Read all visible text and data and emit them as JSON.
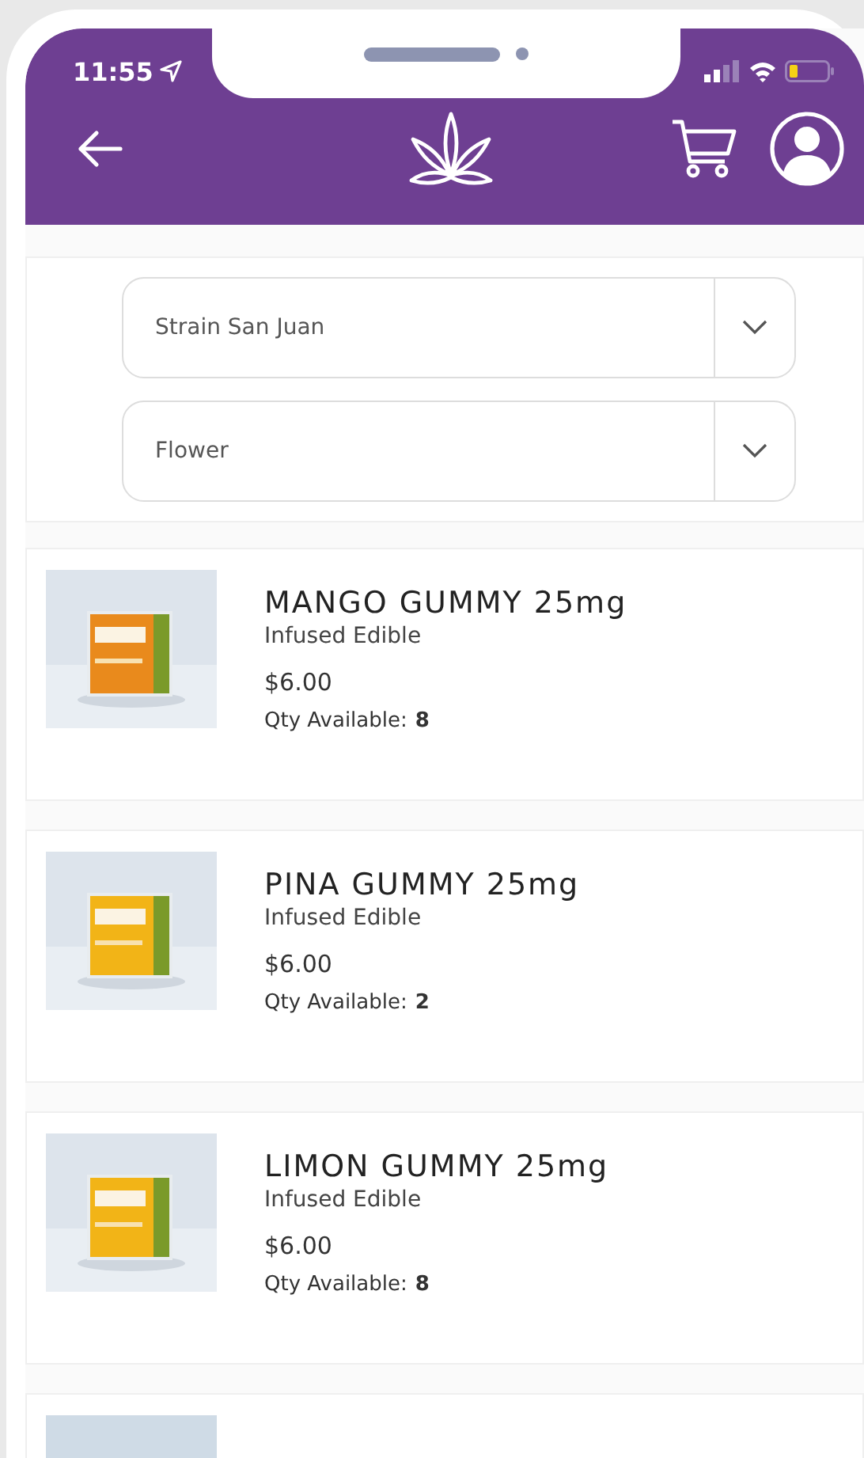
{
  "status_bar": {
    "time": "11:55"
  },
  "filters": [
    {
      "value": "Strain San Juan"
    },
    {
      "value": "Flower"
    }
  ],
  "products": [
    {
      "name": "MANGO GUMMY 25mg",
      "category": "Infused Edible",
      "price": "$6.00",
      "qty_label": "Qty Available:",
      "qty": "8"
    },
    {
      "name": "PINA GUMMY 25mg",
      "category": "Infused Edible",
      "price": "$6.00",
      "qty_label": "Qty Available:",
      "qty": "2"
    },
    {
      "name": "LIMON GUMMY 25mg",
      "category": "Infused Edible",
      "price": "$6.00",
      "qty_label": "Qty Available:",
      "qty": "8"
    }
  ]
}
